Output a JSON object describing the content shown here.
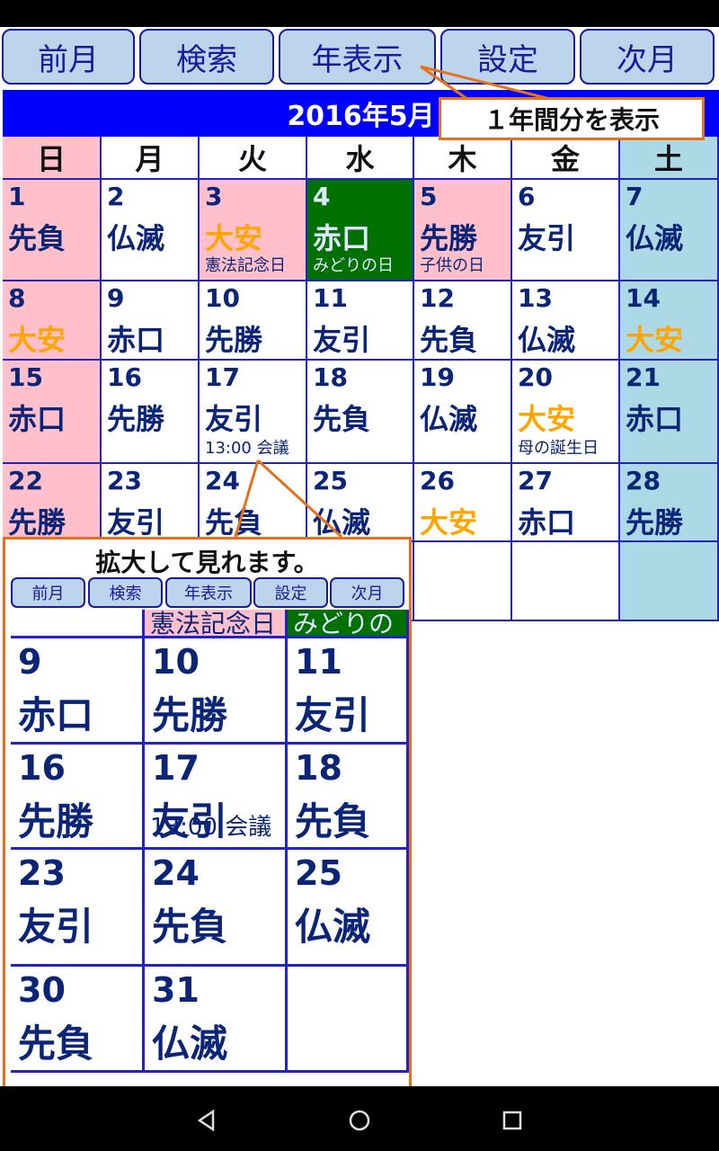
{
  "toolbar": {
    "prev": "前月",
    "search": "検索",
    "year": "年表示",
    "settings": "設定",
    "next": "次月"
  },
  "calendar": {
    "title": "2016年5月",
    "weekdays": [
      "日",
      "月",
      "火",
      "水",
      "木",
      "金",
      "土"
    ],
    "weeks": [
      [
        {
          "day": "1",
          "rokuyo": "先負",
          "event": ""
        },
        {
          "day": "2",
          "rokuyo": "仏滅",
          "event": ""
        },
        {
          "day": "3",
          "rokuyo": "大安",
          "event": "憲法記念日"
        },
        {
          "day": "4",
          "rokuyo": "赤口",
          "event": "みどりの日"
        },
        {
          "day": "5",
          "rokuyo": "先勝",
          "event": "子供の日"
        },
        {
          "day": "6",
          "rokuyo": "友引",
          "event": ""
        },
        {
          "day": "7",
          "rokuyo": "仏滅",
          "event": ""
        }
      ],
      [
        {
          "day": "8",
          "rokuyo": "大安",
          "event": ""
        },
        {
          "day": "9",
          "rokuyo": "赤口",
          "event": ""
        },
        {
          "day": "10",
          "rokuyo": "先勝",
          "event": ""
        },
        {
          "day": "11",
          "rokuyo": "友引",
          "event": ""
        },
        {
          "day": "12",
          "rokuyo": "先負",
          "event": ""
        },
        {
          "day": "13",
          "rokuyo": "仏滅",
          "event": ""
        },
        {
          "day": "14",
          "rokuyo": "大安",
          "event": ""
        }
      ],
      [
        {
          "day": "15",
          "rokuyo": "赤口",
          "event": ""
        },
        {
          "day": "16",
          "rokuyo": "先勝",
          "event": ""
        },
        {
          "day": "17",
          "rokuyo": "友引",
          "event": "13:00 会議"
        },
        {
          "day": "18",
          "rokuyo": "先負",
          "event": ""
        },
        {
          "day": "19",
          "rokuyo": "仏滅",
          "event": ""
        },
        {
          "day": "20",
          "rokuyo": "大安",
          "event": "母の誕生日"
        },
        {
          "day": "21",
          "rokuyo": "赤口",
          "event": ""
        }
      ],
      [
        {
          "day": "22",
          "rokuyo": "先勝",
          "event": ""
        },
        {
          "day": "23",
          "rokuyo": "友引",
          "event": ""
        },
        {
          "day": "24",
          "rokuyo": "先負",
          "event": ""
        },
        {
          "day": "25",
          "rokuyo": "仏滅",
          "event": ""
        },
        {
          "day": "26",
          "rokuyo": "大安",
          "event": ""
        },
        {
          "day": "27",
          "rokuyo": "赤口",
          "event": ""
        },
        {
          "day": "28",
          "rokuyo": "先勝",
          "event": ""
        }
      ]
    ]
  },
  "tooltip": "１年間分を表示",
  "zoom": {
    "caption": "拡大して見れます。",
    "buttons": [
      "前月",
      "検索",
      "年表示",
      "設定",
      "次月"
    ],
    "top_events": [
      "憲法記念日",
      "みどりの"
    ],
    "rows": [
      [
        {
          "day": "9",
          "rokuyo": "赤口",
          "event": ""
        },
        {
          "day": "10",
          "rokuyo": "先勝",
          "event": ""
        },
        {
          "day": "11",
          "rokuyo": "友引",
          "event": ""
        }
      ],
      [
        {
          "day": "16",
          "rokuyo": "先勝",
          "event": ""
        },
        {
          "day": "17",
          "rokuyo": "友引",
          "event": "13:00 会議"
        },
        {
          "day": "18",
          "rokuyo": "先負",
          "event": ""
        }
      ],
      [
        {
          "day": "23",
          "rokuyo": "友引",
          "event": ""
        },
        {
          "day": "24",
          "rokuyo": "先負",
          "event": ""
        },
        {
          "day": "25",
          "rokuyo": "仏滅",
          "event": ""
        }
      ],
      [
        {
          "day": "30",
          "rokuyo": "先負",
          "event": ""
        },
        {
          "day": "31",
          "rokuyo": "仏滅",
          "event": ""
        },
        {
          "day": "",
          "rokuyo": "",
          "event": ""
        }
      ]
    ]
  },
  "nav": {
    "back": "back-icon",
    "home": "home-icon",
    "recents": "recents-icon"
  },
  "colors": {
    "accent": "#0000ff",
    "sunday": "#ffc0cb",
    "saturday": "#add8e6",
    "today": "#007000",
    "taian": "#ffa500",
    "callout": "#e8701a"
  }
}
